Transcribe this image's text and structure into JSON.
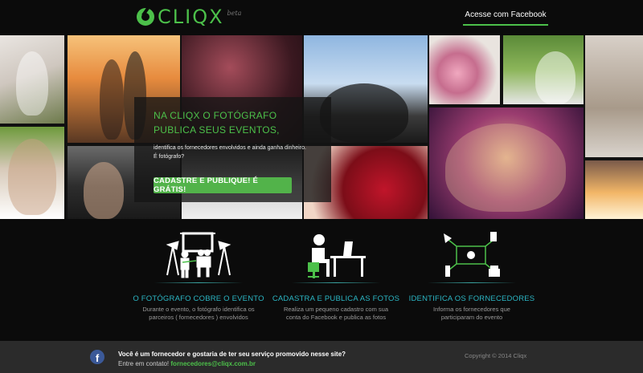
{
  "header": {
    "logo_text": "CLIQX",
    "logo_beta": "beta",
    "login_button": "Acesse com Facebook"
  },
  "hero": {
    "title_line1": "NA CLIQX O FOTÓGRAFO",
    "title_line2": "PUBLICA SEUS EVENTOS,",
    "text_line1": "identifica os fornecedores envolvidos e ainda ganha dinheiro.",
    "text_line2": "É fotógrafo?",
    "cta": "CADASTRE E PUBLIQUE! É GRÁTIS!"
  },
  "features": [
    {
      "icon": "photographer-studio-icon",
      "title": "O FOTÓGRAFO COBRE O EVENTO",
      "desc_line1": "Durante o evento, o fotógrafo identifica os",
      "desc_line2": "parceiros ( fornecedores ) envolvidos"
    },
    {
      "icon": "person-at-laptop-icon",
      "title": "CADASTRA E PUBLICA AS FOTOS",
      "desc_line1": "Realiza um pequeno cadastro com sua",
      "desc_line2": "conta do Facebook e publica as fotos"
    },
    {
      "icon": "supplier-network-icon",
      "title": "IDENTIFICA OS FORNECEDORES",
      "desc_line1": "Informa os fornecedores que",
      "desc_line2": "participaram do evento"
    }
  ],
  "footer": {
    "question": "Você é um fornecedor e gostaria de ter seu serviço promovido nesse site?",
    "contact_prefix": "Entre em contato!",
    "email": "fornecedores@cliqx.com.br",
    "copyright": "Copyright © 2014 Cliqx"
  },
  "colors": {
    "brand_green": "#4cc04a",
    "feature_title": "#2bb6c4",
    "background": "#0b0b0b",
    "footer_bg": "#2b2b2b"
  }
}
